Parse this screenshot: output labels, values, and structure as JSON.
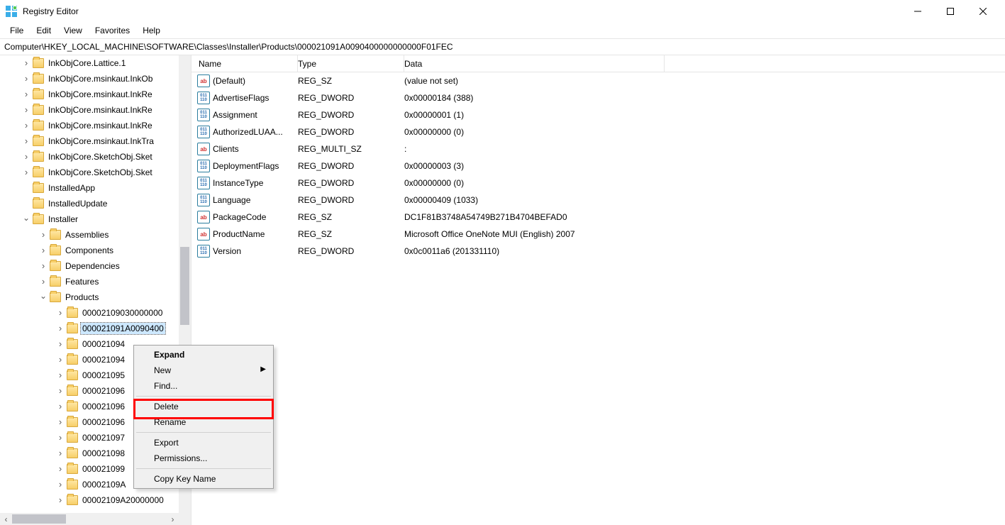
{
  "window": {
    "title": "Registry Editor"
  },
  "menu": {
    "file": "File",
    "edit": "Edit",
    "view": "View",
    "favorites": "Favorites",
    "help": "Help"
  },
  "address": "Computer\\HKEY_LOCAL_MACHINE\\SOFTWARE\\Classes\\Installer\\Products\\000021091A0090400000000000F01FEC",
  "tree": {
    "items": [
      {
        "indent": 1,
        "exp": "right",
        "label": "InkObjCore.Lattice.1"
      },
      {
        "indent": 1,
        "exp": "right",
        "label": "InkObjCore.msinkaut.InkOb"
      },
      {
        "indent": 1,
        "exp": "right",
        "label": "InkObjCore.msinkaut.InkRe"
      },
      {
        "indent": 1,
        "exp": "right",
        "label": "InkObjCore.msinkaut.InkRe"
      },
      {
        "indent": 1,
        "exp": "right",
        "label": "InkObjCore.msinkaut.InkRe"
      },
      {
        "indent": 1,
        "exp": "right",
        "label": "InkObjCore.msinkaut.InkTra"
      },
      {
        "indent": 1,
        "exp": "right",
        "label": "InkObjCore.SketchObj.Sket"
      },
      {
        "indent": 1,
        "exp": "right",
        "label": "InkObjCore.SketchObj.Sket"
      },
      {
        "indent": 1,
        "exp": "none",
        "label": "InstalledApp"
      },
      {
        "indent": 1,
        "exp": "none",
        "label": "InstalledUpdate"
      },
      {
        "indent": 1,
        "exp": "down",
        "label": "Installer"
      },
      {
        "indent": 2,
        "exp": "right",
        "label": "Assemblies"
      },
      {
        "indent": 2,
        "exp": "right",
        "label": "Components"
      },
      {
        "indent": 2,
        "exp": "right",
        "label": "Dependencies"
      },
      {
        "indent": 2,
        "exp": "right",
        "label": "Features"
      },
      {
        "indent": 2,
        "exp": "down",
        "label": "Products"
      },
      {
        "indent": 3,
        "exp": "right",
        "label": "00002109030000000"
      },
      {
        "indent": 3,
        "exp": "right",
        "label": "000021091A0090400",
        "selected": true
      },
      {
        "indent": 3,
        "exp": "right",
        "label": "000021094"
      },
      {
        "indent": 3,
        "exp": "right",
        "label": "000021094"
      },
      {
        "indent": 3,
        "exp": "right",
        "label": "000021095"
      },
      {
        "indent": 3,
        "exp": "right",
        "label": "000021096"
      },
      {
        "indent": 3,
        "exp": "right",
        "label": "000021096"
      },
      {
        "indent": 3,
        "exp": "right",
        "label": "000021096"
      },
      {
        "indent": 3,
        "exp": "right",
        "label": "000021097"
      },
      {
        "indent": 3,
        "exp": "right",
        "label": "000021098"
      },
      {
        "indent": 3,
        "exp": "right",
        "label": "000021099"
      },
      {
        "indent": 3,
        "exp": "right",
        "label": "00002109A"
      },
      {
        "indent": 3,
        "exp": "right",
        "label": "00002109A20000000"
      }
    ]
  },
  "values": {
    "headers": {
      "name": "Name",
      "type": "Type",
      "data": "Data"
    },
    "rows": [
      {
        "icon": "str",
        "name": "(Default)",
        "type": "REG_SZ",
        "data": "(value not set)"
      },
      {
        "icon": "bin",
        "name": "AdvertiseFlags",
        "type": "REG_DWORD",
        "data": "0x00000184 (388)"
      },
      {
        "icon": "bin",
        "name": "Assignment",
        "type": "REG_DWORD",
        "data": "0x00000001 (1)"
      },
      {
        "icon": "bin",
        "name": "AuthorizedLUAA...",
        "type": "REG_DWORD",
        "data": "0x00000000 (0)"
      },
      {
        "icon": "str",
        "name": "Clients",
        "type": "REG_MULTI_SZ",
        "data": ":"
      },
      {
        "icon": "bin",
        "name": "DeploymentFlags",
        "type": "REG_DWORD",
        "data": "0x00000003 (3)"
      },
      {
        "icon": "bin",
        "name": "InstanceType",
        "type": "REG_DWORD",
        "data": "0x00000000 (0)"
      },
      {
        "icon": "bin",
        "name": "Language",
        "type": "REG_DWORD",
        "data": "0x00000409 (1033)"
      },
      {
        "icon": "str",
        "name": "PackageCode",
        "type": "REG_SZ",
        "data": "DC1F81B3748A54749B271B4704BEFAD0"
      },
      {
        "icon": "str",
        "name": "ProductName",
        "type": "REG_SZ",
        "data": "Microsoft Office OneNote MUI (English) 2007"
      },
      {
        "icon": "bin",
        "name": "Version",
        "type": "REG_DWORD",
        "data": "0x0c0011a6 (201331110)"
      }
    ]
  },
  "context_menu": {
    "expand": "Expand",
    "new": "New",
    "find": "Find...",
    "delete": "Delete",
    "rename": "Rename",
    "export": "Export",
    "permissions": "Permissions...",
    "copy_key": "Copy Key Name"
  }
}
